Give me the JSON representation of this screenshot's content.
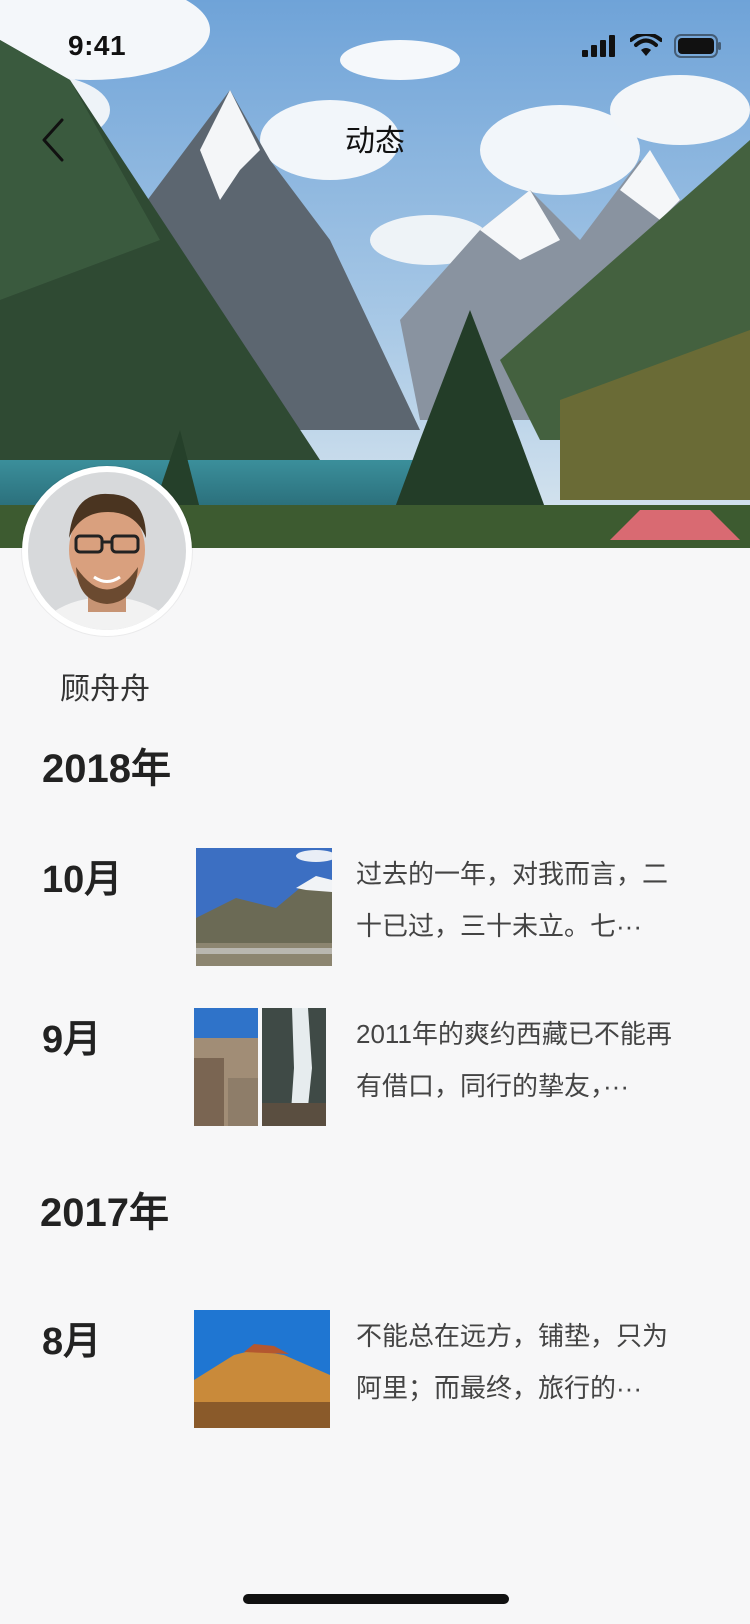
{
  "status": {
    "time": "9:41"
  },
  "nav": {
    "title": "动态"
  },
  "profile": {
    "name": "顾舟舟"
  },
  "timeline": [
    {
      "year": "2018年",
      "entries": [
        {
          "month": "10月",
          "lines": [
            "过去的一年，对我而言，二",
            "十已过，三十未立。七···"
          ]
        },
        {
          "month": "9月",
          "lines": [
            "2011年的爽约西藏已不能再",
            "有借口，同行的挚友，···"
          ]
        }
      ]
    },
    {
      "year": "2017年",
      "entries": [
        {
          "month": "8月",
          "lines": [
            "不能总在远方，铺垫，只为",
            "阿里；而最终，旅行的···"
          ]
        }
      ]
    }
  ]
}
